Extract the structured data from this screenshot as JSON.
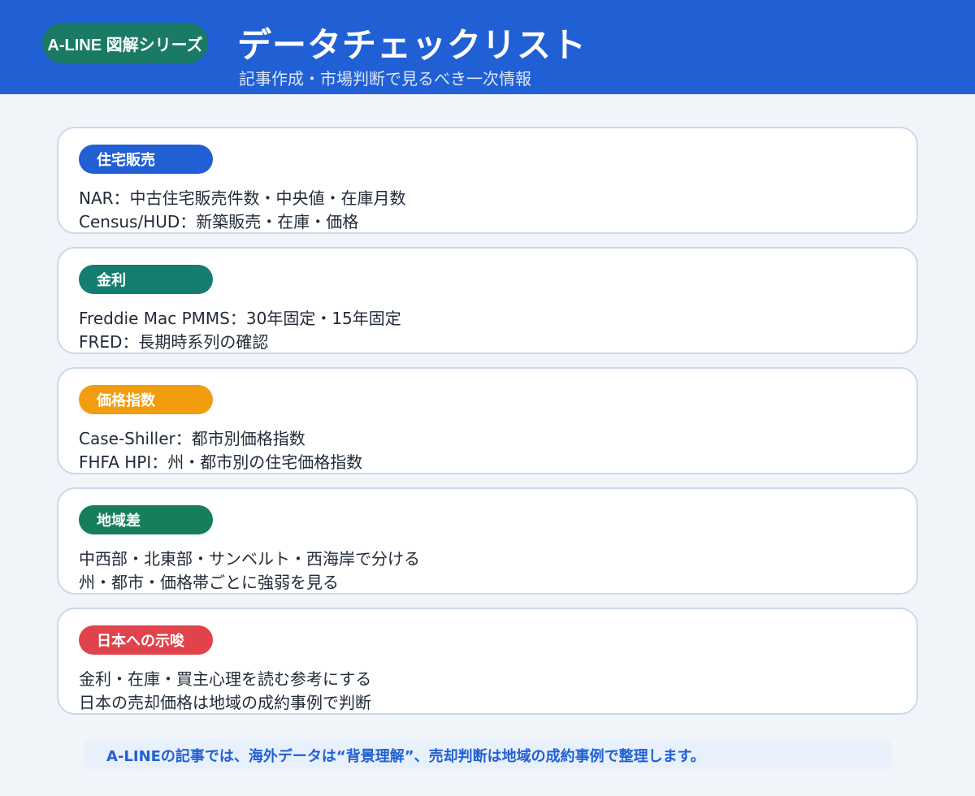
{
  "header": {
    "series_label": "A-LINE 図解シリーズ",
    "title": "データチェックリスト",
    "subtitle": "記事作成・市場判断で見るべき一次情報",
    "colors": {
      "background": "#2160d4",
      "series_pill": "#1a7a66"
    }
  },
  "cards": [
    {
      "tag": "住宅販売",
      "tag_color": "#2160d4",
      "lines": [
        "NAR：中古住宅販売件数・中央値・在庫月数",
        "Census/HUD：新築販売・在庫・価格"
      ]
    },
    {
      "tag": "金利",
      "tag_color": "#157d70",
      "lines": [
        "Freddie Mac PMMS：30年固定・15年固定",
        "FRED：長期時系列の確認"
      ]
    },
    {
      "tag": "価格指数",
      "tag_color": "#f29d0f",
      "lines": [
        "Case-Shiller：都市別価格指数",
        "FHFA HPI：州・都市別の住宅価格指数"
      ]
    },
    {
      "tag": "地域差",
      "tag_color": "#177e5c",
      "lines": [
        "中西部・北東部・サンベルト・西海岸で分ける",
        "州・都市・価格帯ごとに強弱を見る"
      ]
    },
    {
      "tag": "日本への示唆",
      "tag_color": "#e0434b",
      "lines": [
        "金利・在庫・買主心理を読む参考にする",
        "日本の売却価格は地域の成約事例で判断"
      ]
    }
  ],
  "footer": {
    "note": "A-LINEの記事では、海外データは“背景理解”、売却判断は地域の成約事例で整理します。"
  }
}
